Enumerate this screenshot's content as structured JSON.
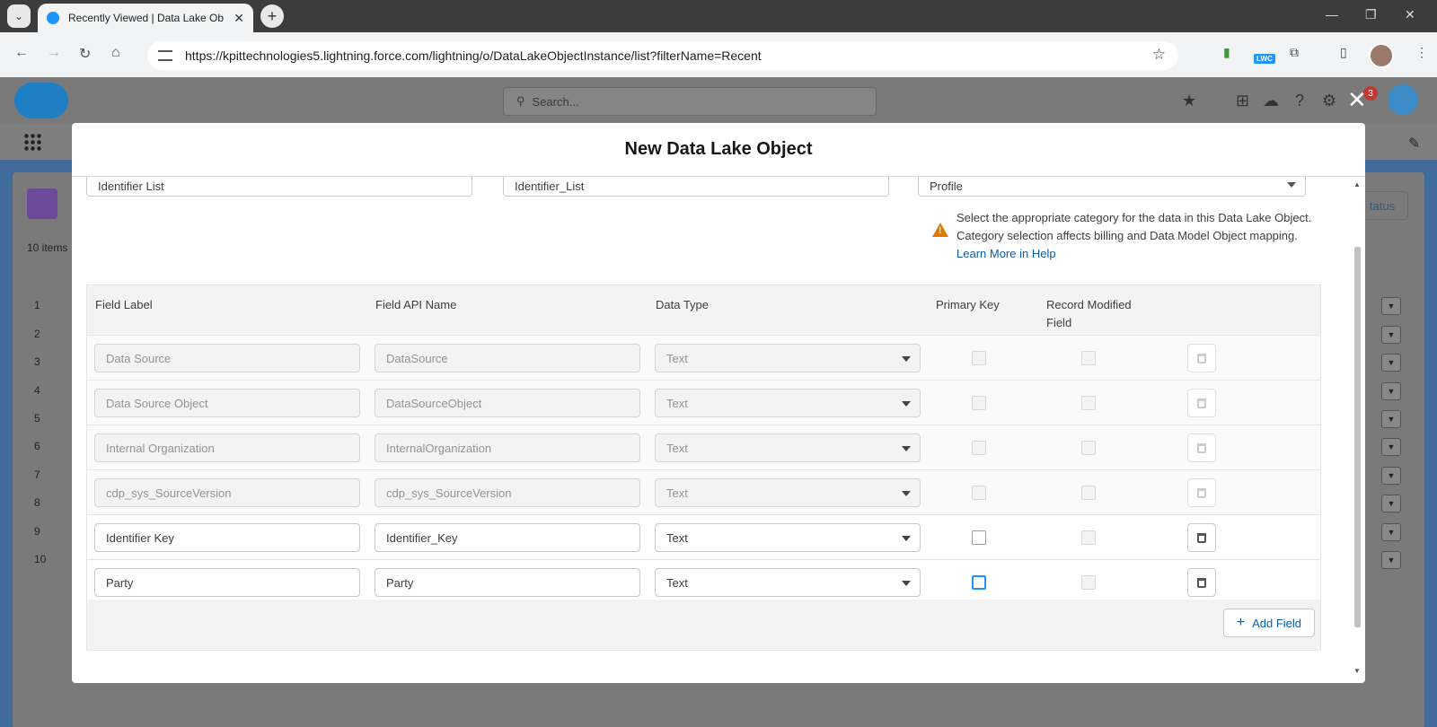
{
  "browser": {
    "tab_title": "Recently Viewed | Data Lake Ob",
    "url": "https://kpittechnologies5.lightning.force.com/lightning/o/DataLakeObjectInstance/list?filterName=Recent",
    "ext_badge": "LWC"
  },
  "sf": {
    "search_placeholder": "Search...",
    "item_count": "10 items",
    "status_label": "tatus",
    "notification_count": "3",
    "row_numbers": [
      "1",
      "2",
      "3",
      "4",
      "5",
      "6",
      "7",
      "8",
      "9",
      "10"
    ]
  },
  "modal": {
    "title": "New Data Lake Object",
    "object_label_value": "Identifier List",
    "object_api_value": "Identifier_List",
    "category_value": "Profile",
    "warning_text": "Select the appropriate category for the data in this Data Lake Object. Category selection affects billing and Data Model Object mapping.",
    "warning_link": "Learn More in Help",
    "columns": {
      "field_label": "Field Label",
      "field_api": "Field API Name",
      "data_type": "Data Type",
      "primary_key": "Primary Key",
      "record_modified_1": "Record Modified",
      "record_modified_2": "Field"
    },
    "rows": [
      {
        "label": "Data Source",
        "api": "DataSource",
        "type": "Text"
      },
      {
        "label": "Data Source Object",
        "api": "DataSourceObject",
        "type": "Text"
      },
      {
        "label": "Internal Organization",
        "api": "InternalOrganization",
        "type": "Text"
      },
      {
        "label": "cdp_sys_SourceVersion",
        "api": "cdp_sys_SourceVersion",
        "type": "Text"
      },
      {
        "label": "Identifier Key",
        "api": "Identifier_Key",
        "type": "Text"
      },
      {
        "label": "Party",
        "api": "Party",
        "type": "Text"
      }
    ],
    "add_field_label": "Add Field"
  }
}
